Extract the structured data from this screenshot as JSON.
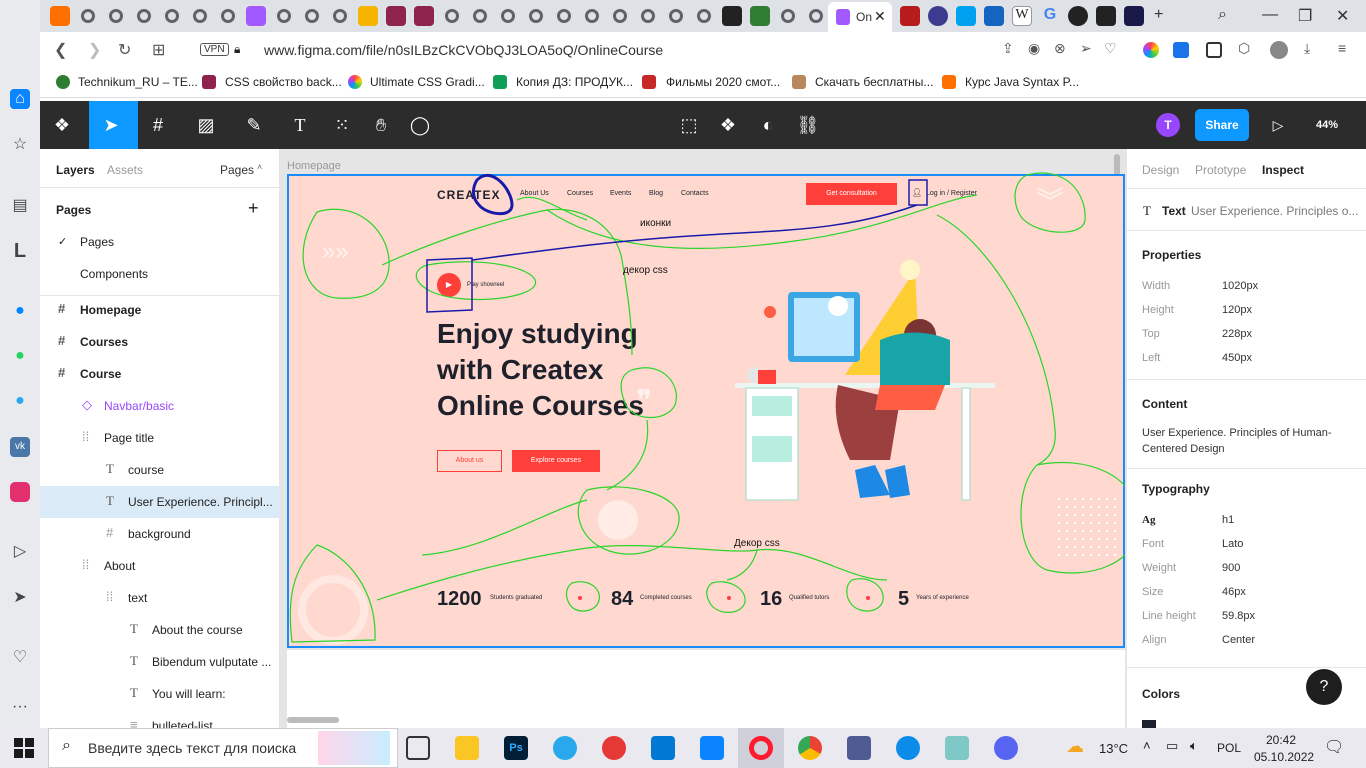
{
  "browser": {
    "active_tab_title": "On",
    "url": "www.figma.com/file/n0sILBzCkCVObQJ3LOA5oQ/OnlineCourse",
    "vpn_label": "VPN",
    "bookmarks": [
      "Technikum_RU – TE...",
      "CSS свойство back...",
      "Ultimate CSS Gradi...",
      "Копия ДЗ: ПРОДУК...",
      "Фильмы 2020 смот...",
      "Скачать бесплатны...",
      "Курс Java Syntax P..."
    ]
  },
  "figma": {
    "avatar_letter": "T",
    "share_label": "Share",
    "zoom": "44%",
    "left_panel": {
      "tabs": [
        "Layers",
        "Assets"
      ],
      "pages_dropdown": "Pages",
      "pages_header": "Pages",
      "pages": [
        "Pages",
        "Components"
      ],
      "layers": [
        {
          "label": "Homepage",
          "type": "frame"
        },
        {
          "label": "Courses",
          "type": "frame"
        },
        {
          "label": "Course",
          "type": "frame"
        },
        {
          "label": "Navbar/basic",
          "type": "component"
        },
        {
          "label": "Page title",
          "type": "group"
        },
        {
          "label": "course",
          "type": "text"
        },
        {
          "label": "User Experience. Principl...",
          "type": "text"
        },
        {
          "label": "background",
          "type": "frame"
        },
        {
          "label": "About",
          "type": "group"
        },
        {
          "label": "text",
          "type": "group"
        },
        {
          "label": "About the course",
          "type": "text"
        },
        {
          "label": "Bibendum vulputate ...",
          "type": "text"
        },
        {
          "label": "You will learn:",
          "type": "text"
        },
        {
          "label": "bulleted-list",
          "type": "list"
        }
      ]
    },
    "canvas": {
      "frame_label": "Homepage",
      "site": {
        "logo": "CREATEX",
        "nav": [
          "About Us",
          "Courses",
          "Events",
          "Blog",
          "Contacts"
        ],
        "cta": "Get consultation",
        "login": "Log in / Register",
        "play": "Play showreel",
        "headline": [
          "Enjoy studying",
          "with Createx",
          "Online Courses"
        ],
        "btn_about": "About us",
        "btn_explore": "Explore courses",
        "stats": [
          {
            "num": "1200",
            "label": "Students graduated"
          },
          {
            "num": "84",
            "label": "Completed courses"
          },
          {
            "num": "16",
            "label": "Qualified tutors"
          },
          {
            "num": "5",
            "label": "Years of experience"
          }
        ]
      },
      "annotations": [
        "иконки",
        "декор css",
        "Декор css"
      ]
    },
    "right_panel": {
      "tabs": [
        "Design",
        "Prototype",
        "Inspect"
      ],
      "layer_type": "Text",
      "layer_name": "User Experience. Principles o...",
      "properties_title": "Properties",
      "properties": [
        {
          "k": "Width",
          "v": "1020px"
        },
        {
          "k": "Height",
          "v": "120px"
        },
        {
          "k": "Top",
          "v": "228px"
        },
        {
          "k": "Left",
          "v": "450px"
        }
      ],
      "content_title": "Content",
      "content": "User Experience. Principles of Human-Centered Design",
      "typography_title": "Typography",
      "typography": [
        {
          "k": "Ag",
          "v": "h1"
        },
        {
          "k": "Font",
          "v": "Lato"
        },
        {
          "k": "Weight",
          "v": "900"
        },
        {
          "k": "Size",
          "v": "46px"
        },
        {
          "k": "Line height",
          "v": "59.8px"
        },
        {
          "k": "Align",
          "v": "Center"
        }
      ],
      "colors_title": "Colors",
      "help": "?"
    }
  },
  "taskbar": {
    "search_placeholder": "Введите здесь текст для поиска",
    "weather": "13°C",
    "lang": "POL",
    "time": "20:42",
    "date": "05.10.2022"
  },
  "colors": {
    "figma_blue": "#0d99ff",
    "toolbar": "#2c2c2c",
    "frame_bg": "#ffd9cf",
    "accent_orange": "#ff3f3a",
    "annotation_green": "#2bd42b",
    "annotation_blue": "#1a1aa8"
  }
}
